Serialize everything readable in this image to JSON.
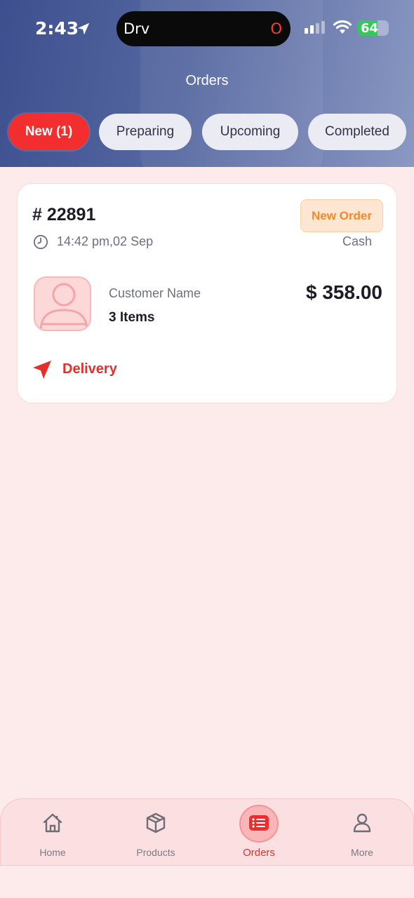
{
  "status_bar": {
    "time": "2:43",
    "island_label": "Drv",
    "island_indicator": "O",
    "battery": "64",
    "battery_level": 0.64
  },
  "header": {
    "title": "Orders",
    "tabs": [
      {
        "label": "New (1)",
        "active": true
      },
      {
        "label": "Preparing",
        "active": false
      },
      {
        "label": "Upcoming",
        "active": false
      },
      {
        "label": "Completed",
        "active": false
      }
    ]
  },
  "orders": [
    {
      "id": "# 22891",
      "time": "14:42 pm,02 Sep",
      "status": "New Order",
      "payment": "Cash",
      "customer_label": "Customer Name",
      "items": "3 Items",
      "total": "$ 358.00",
      "type": "Delivery"
    }
  ],
  "bottom_nav": [
    {
      "label": "Home",
      "icon": "home-icon",
      "active": false
    },
    {
      "label": "Products",
      "icon": "box-icon",
      "active": false
    },
    {
      "label": "Orders",
      "icon": "orders-list-icon",
      "active": true
    },
    {
      "label": "More",
      "icon": "user-icon",
      "active": false
    }
  ],
  "colors": {
    "accent": "#f32e2e",
    "header_start": "#3d4f8e",
    "header_end": "#8a98c2",
    "background": "#fdeaeb",
    "badge_text": "#f08a2a"
  }
}
